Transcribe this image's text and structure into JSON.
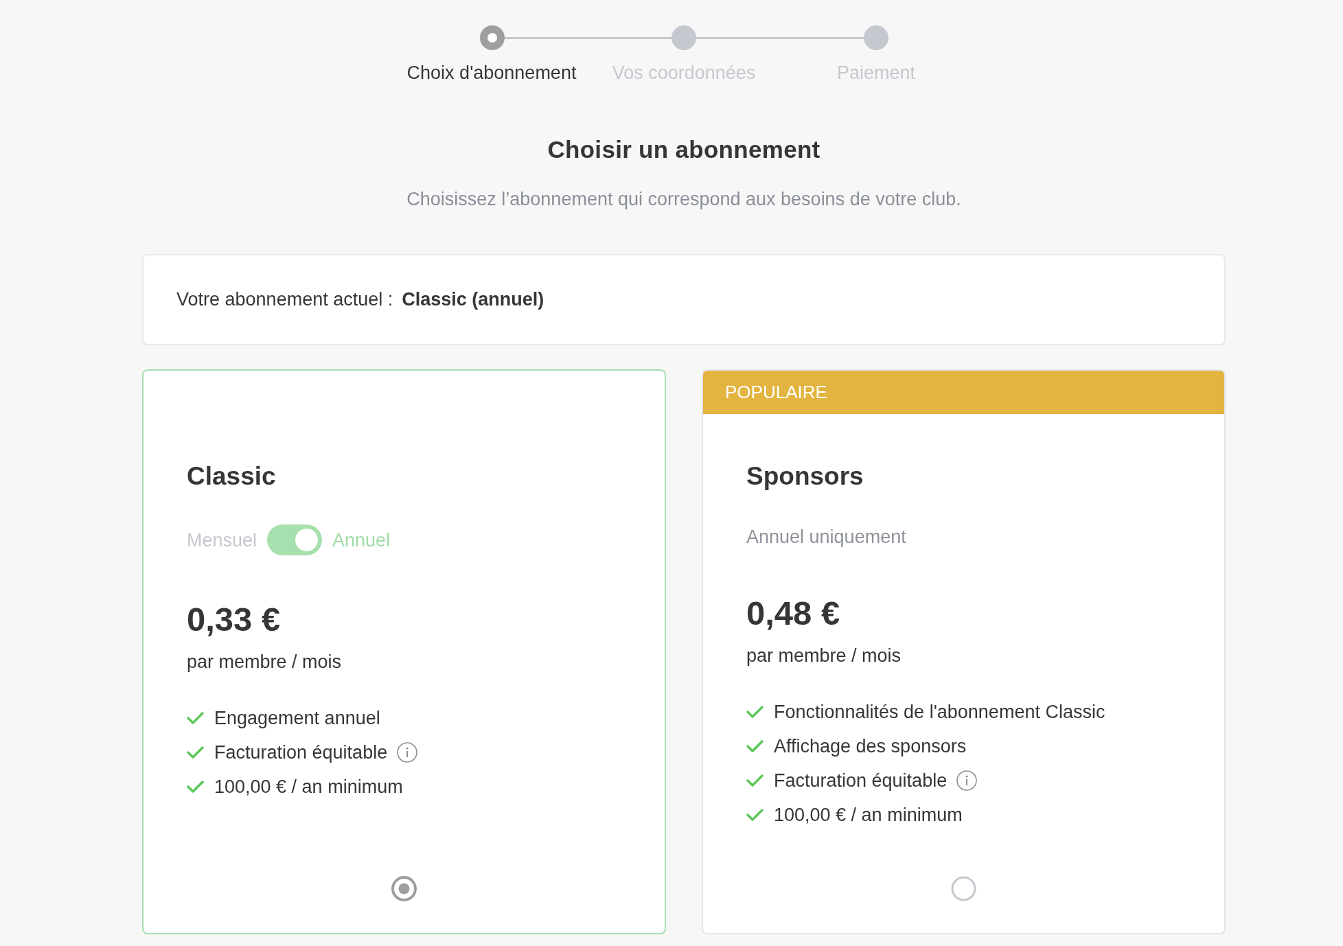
{
  "steps": [
    {
      "label": "Choix d'abonnement",
      "selected": true
    },
    {
      "label": "Vos coordonnées",
      "selected": false
    },
    {
      "label": "Paiement",
      "selected": false
    }
  ],
  "heading": {
    "title": "Choisir un abonnement",
    "subtitle": "Choisissez l’abonnement qui correspond aux besoins de votre club."
  },
  "current_plan": {
    "label": "Votre abonnement actuel :",
    "value": "Classic (annuel)"
  },
  "plans": [
    {
      "name": "Classic",
      "selected": true,
      "billing": {
        "kind": "toggle",
        "off_label": "Mensuel",
        "on_label": "Annuel",
        "on": true
      },
      "price": "0,33 €",
      "unit": "par membre / mois",
      "features": [
        {
          "text": "Engagement annuel",
          "info": false
        },
        {
          "text": "Facturation équitable",
          "info": true
        },
        {
          "text": "100,00 € / an minimum",
          "info": false
        }
      ]
    },
    {
      "name": "Sponsors",
      "selected": false,
      "badge": "POPULAIRE",
      "billing": {
        "kind": "note",
        "text": "Annuel uniquement"
      },
      "price": "0,48 €",
      "unit": "par membre / mois",
      "features": [
        {
          "text": "Fonctionnalités de l'abonnement Classic",
          "info": false
        },
        {
          "text": "Affichage des sponsors",
          "info": false
        },
        {
          "text": "Facturation équitable",
          "info": true
        },
        {
          "text": "100,00 € / an minimum",
          "info": false
        }
      ]
    }
  ]
}
